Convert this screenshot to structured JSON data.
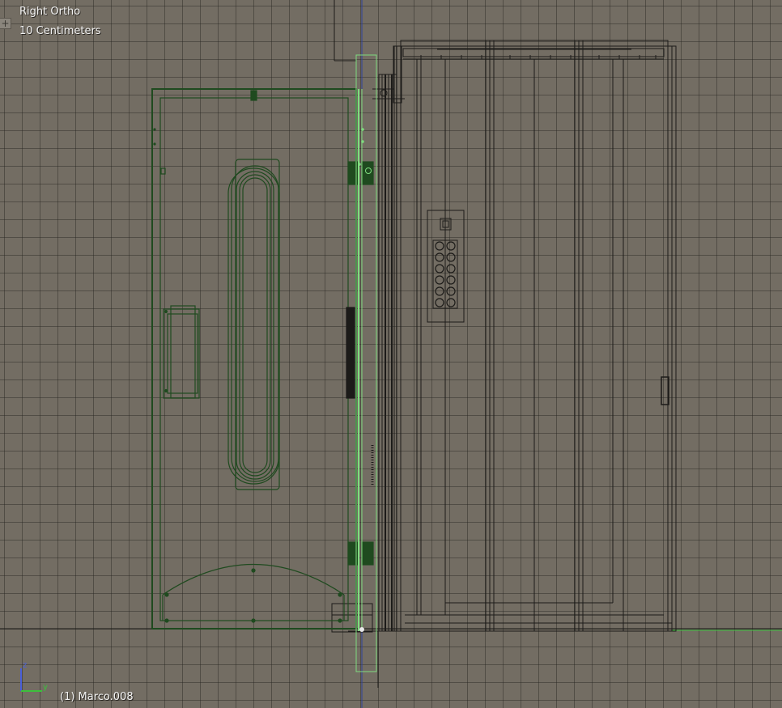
{
  "viewport": {
    "view_name": "Right Ortho",
    "grid_scale": "10 Centimeters",
    "object_info": "(1) Marco.008",
    "toolshelf_toggle": "+"
  },
  "axis_gizmo": {
    "z_label": "z",
    "y_label": "y"
  },
  "colors": {
    "background": "#736d63",
    "grid_line": "#4a463f",
    "wire": "#1c1b19",
    "selected_dark": "#1f4a1f",
    "active_light": "#7fdc7f",
    "z_axis": "#4a5fd8",
    "y_axis": "#3cbf3c"
  },
  "icons": {
    "toolshelf": "plus-icon",
    "axis": "axis-gizmo-icon"
  }
}
